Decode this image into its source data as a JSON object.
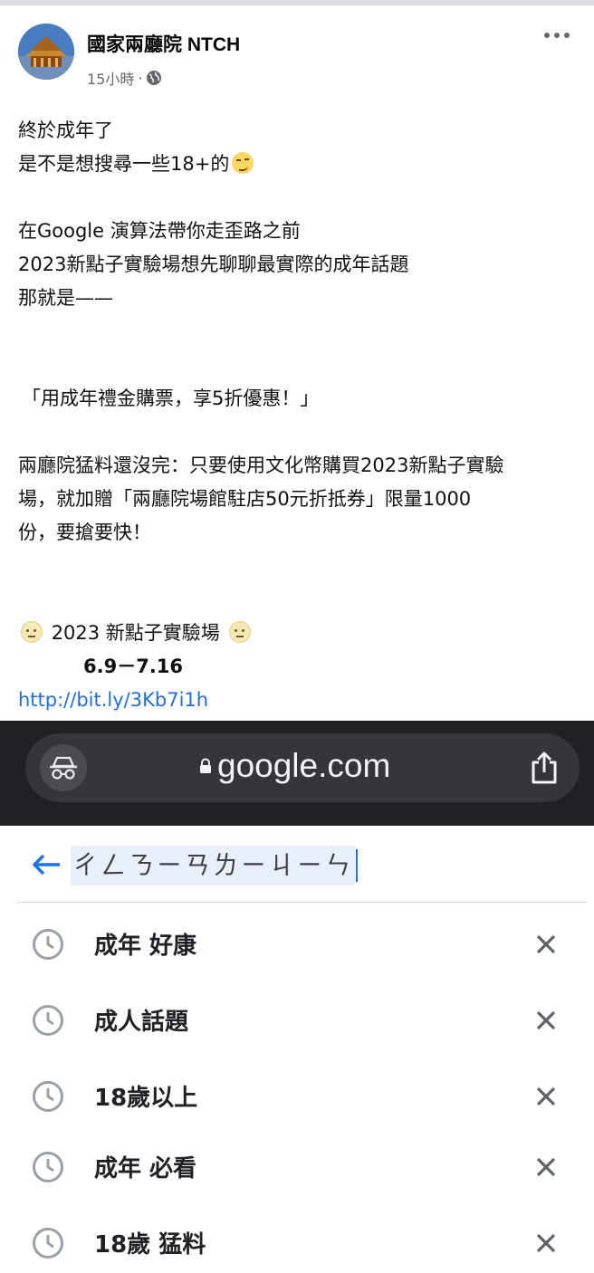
{
  "post": {
    "page_name": "國家兩廳院 NTCH",
    "timestamp": "15小時",
    "separator": "·",
    "lines": {
      "l1": "終於成年了",
      "l2": "是不是想搜尋一些18+的",
      "l3": "在Google 演算法帶你走歪路之前",
      "l4": "2023新點子實驗場想先聊聊最實際的成年話題",
      "l5": "那就是——",
      "l6": "「用成年禮金購票，享5折優惠！」",
      "l7": "兩廳院猛料還沒完：只要使用文化幣購買2023新點子實驗",
      "l8": "場，就加贈「兩廳院場館駐店50元折抵券」限量1000",
      "l9": "份，要搶要快！",
      "event_name": "2023 新點子實驗場",
      "dates": "6.9－7.16",
      "link": "http://bit.ly/3Kb7i1h"
    },
    "icons": {
      "emoji": "smirking-face",
      "event_emoji": "neutral-face"
    }
  },
  "browser": {
    "url": "google.com",
    "icons": [
      "incognito-icon",
      "lock-icon",
      "share-icon"
    ]
  },
  "search": {
    "query": "ㄔㄥㄋㄧㄢㄌㄧㄐㄧㄣ",
    "suggestions": [
      {
        "text": "成年 好康"
      },
      {
        "text": "成人話題"
      },
      {
        "text": "18歲以上"
      },
      {
        "text": "成年 必看"
      },
      {
        "text": "18歲 猛料"
      }
    ]
  },
  "colors": {
    "link": "#216fdb",
    "browser_bg": "#202124",
    "accent": "#1a73e8"
  }
}
